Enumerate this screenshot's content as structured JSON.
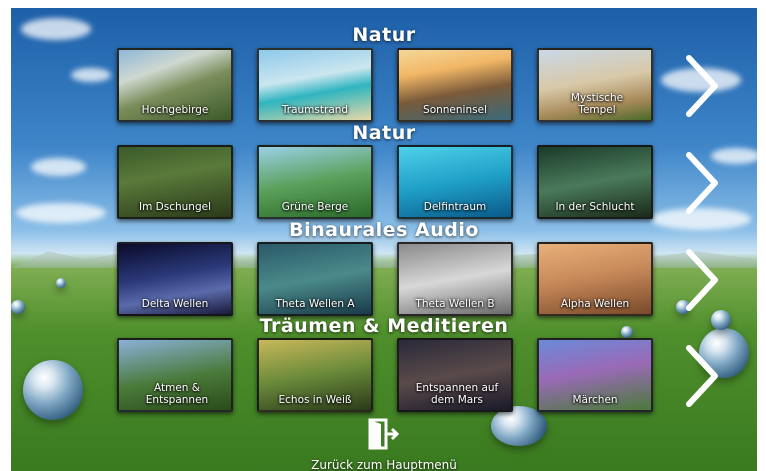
{
  "sections": [
    {
      "title": "Natur",
      "tiles": [
        {
          "label": "Hochgebirge",
          "bg": "linear-gradient(160deg,#8fb7d8 0%,#cfd8d0 30%,#7a8d5a 55%,#3c5a2a 100%)"
        },
        {
          "label": "Traumstrand",
          "bg": "linear-gradient(170deg,#8ec9ea 0%,#cbe6ef 40%,#2fb5c0 60%,#e8d8a8 100%)"
        },
        {
          "label": "Sonneninsel",
          "bg": "linear-gradient(170deg,#f4d79a 0%,#f2b766 30%,#7a5a3a 60%,#3a6a7a 100%)"
        },
        {
          "label": "Mystische Tempel",
          "bg": "linear-gradient(170deg,#c9d8e6 0%,#d8c9a8 45%,#a88a5a 75%,#4a6a2a 100%)"
        }
      ]
    },
    {
      "title": "Natur",
      "tiles": [
        {
          "label": "Im Dschungel",
          "bg": "linear-gradient(170deg,#3a5a2a 0%,#5a7a3a 40%,#2a3a1a 100%)"
        },
        {
          "label": "Grüne Berge",
          "bg": "linear-gradient(170deg,#9ad0e6 0%,#5aa05a 50%,#2a6a2a 100%)"
        },
        {
          "label": "Delfintraum",
          "bg": "linear-gradient(170deg,#4fd0e8 0%,#1fa0c8 50%,#0a5a8a 100%)"
        },
        {
          "label": "In der Schlucht",
          "bg": "linear-gradient(170deg,#1a3a2a 0%,#4a7a5a 50%,#1a2a1a 100%)"
        }
      ]
    },
    {
      "title": "Binaurales Audio",
      "tiles": [
        {
          "label": "Delta Wellen",
          "bg": "linear-gradient(170deg,#0a0a2a 0%,#2a3a7a 45%,#5a6aaa 70%,#1a1a3a 100%)"
        },
        {
          "label": "Theta Wellen A",
          "bg": "linear-gradient(170deg,#2a5a6a 0%,#4a8a8a 50%,#1a3a4a 100%)"
        },
        {
          "label": "Theta Wellen B",
          "bg": "linear-gradient(170deg,#8a8a8a 0%,#d8d8d8 50%,#6a6a6a 100%)"
        },
        {
          "label": "Alpha Wellen",
          "bg": "linear-gradient(170deg,#e8b07a 0%,#c88a5a 45%,#7a4a2a 100%)"
        }
      ]
    },
    {
      "title": "Träumen & Meditieren",
      "tiles": [
        {
          "label": "Atmen & Entspannen",
          "bg": "linear-gradient(170deg,#8ab0d8 0%,#4a7a3a 55%,#2a4a1a 100%)"
        },
        {
          "label": "Echos in Weiß",
          "bg": "linear-gradient(170deg,#c8b85a 0%,#6a8a3a 50%,#2a3a1a 100%)"
        },
        {
          "label": "Entspannen auf dem Mars",
          "bg": "linear-gradient(170deg,#2a2a3a 0%,#5a4a4a 50%,#1a1a2a 100%)"
        },
        {
          "label": "Märchen",
          "bg": "linear-gradient(170deg,#6a8ad8 0%,#9a6ab8 45%,#4a7a3a 100%)"
        }
      ]
    }
  ],
  "back": {
    "label": "Zurück zum Hauptmenü",
    "icon": "exit-door-icon"
  }
}
